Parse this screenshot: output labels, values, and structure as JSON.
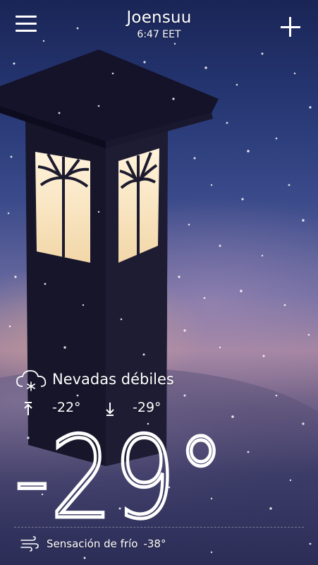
{
  "header": {
    "city": "Joensuu",
    "local_time": "6:47 EET",
    "menu_icon": "hamburger-menu-icon",
    "add_icon": "plus-icon"
  },
  "conditions": {
    "icon": "cloud-snow-icon",
    "description": "Nevadas débiles",
    "high": "-22°",
    "low": "-29°",
    "high_icon": "arrow-up-icon",
    "low_icon": "arrow-down-icon"
  },
  "temperature": {
    "current": "-29°"
  },
  "feels_like": {
    "icon": "wind-icon",
    "label": "Sensación de frío",
    "value": "-38°"
  },
  "colors": {
    "text": "#ffffff",
    "sky_top": "#1a2556",
    "sky_glow": "#a3849f",
    "lamp_light": "#f6e6c8"
  }
}
